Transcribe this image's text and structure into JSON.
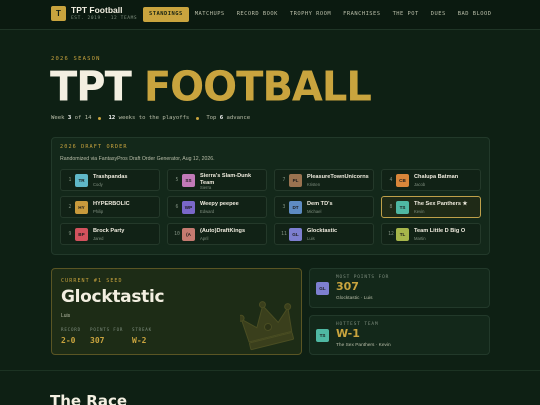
{
  "brand": {
    "logo_letter": "T",
    "name": "TPT Football",
    "subtitle": "EST. 2019 · 12 TEAMS"
  },
  "nav": {
    "items": [
      {
        "label": "STANDINGS",
        "active": true
      },
      {
        "label": "MATCHUPS",
        "active": false
      },
      {
        "label": "RECORD BOOK",
        "active": false
      },
      {
        "label": "TROPHY ROOM",
        "active": false
      },
      {
        "label": "FRANCHISES",
        "active": false
      },
      {
        "label": "THE POT",
        "active": false
      },
      {
        "label": "DUES",
        "active": false
      },
      {
        "label": "BAD BLOOD",
        "active": false
      }
    ]
  },
  "hero": {
    "season_label": "2026 SEASON",
    "title_white": "TPT",
    "title_gold": "FOOTBALL",
    "week_prefix": "Week",
    "week_current": "3",
    "week_of": "of 14",
    "weeks_left": "12",
    "weeks_left_suffix": "weeks to the playoffs",
    "top_prefix": "Top",
    "top_count": "6",
    "top_suffix": "advance"
  },
  "draft": {
    "heading": "2026 DRAFT ORDER",
    "note": "Randomized via FantasyPros Draft Order Generator, Aug 12, 2026.",
    "picks": [
      {
        "num": "1",
        "abbr": "TR",
        "name": "Trashpandas",
        "owner": "Cody",
        "color": "#5fb7c7"
      },
      {
        "num": "5",
        "abbr": "SS",
        "name": "Sierra's Slam-Dunk Team",
        "owner": "Sierra",
        "color": "#c27ab8"
      },
      {
        "num": "7",
        "abbr": "PL",
        "name": "PleasureTownUnicorns",
        "owner": "Kristen",
        "color": "#9a7350"
      },
      {
        "num": "4",
        "abbr": "CB",
        "name": "Chalupa Batman",
        "owner": "Jacob",
        "color": "#d9863a"
      },
      {
        "num": "2",
        "abbr": "HY",
        "name": "HYPERBOLIC",
        "owner": "Philip",
        "color": "#c89a3c"
      },
      {
        "num": "6",
        "abbr": "WP",
        "name": "Weepy peepee",
        "owner": "Edward",
        "color": "#7a67c9"
      },
      {
        "num": "3",
        "abbr": "DT",
        "name": "Dem TD's",
        "owner": "Michael",
        "color": "#5e8bc2"
      },
      {
        "num": "8",
        "abbr": "TS",
        "name": "The Sex Panthers ★",
        "owner": "Kevin",
        "color": "#4fb8a3",
        "highlight": true
      },
      {
        "num": "9",
        "abbr": "BP",
        "name": "Brock Party",
        "owner": "Jared",
        "color": "#d2525d"
      },
      {
        "num": "10",
        "abbr": "(A",
        "name": "(Auto)DraftKings",
        "owner": "April",
        "color": "#c47a70"
      },
      {
        "num": "11",
        "abbr": "GL",
        "name": "Glocktastic",
        "owner": "Luis",
        "color": "#7d7fd0"
      },
      {
        "num": "12",
        "abbr": "TL",
        "name": "Team Little D Big O",
        "owner": "Martin",
        "color": "#a7b64b"
      }
    ]
  },
  "champion": {
    "tag": "CURRENT #1 SEED",
    "name": "Glocktastic",
    "owner": "Luis",
    "stats": [
      {
        "label": "RECORD",
        "value": "2-0"
      },
      {
        "label": "POINTS FOR",
        "value": "307"
      },
      {
        "label": "STREAK",
        "value": "W-2"
      }
    ]
  },
  "most_points": {
    "label": "MOST POINTS FOR",
    "abbr": "GL",
    "value": "307",
    "sub": "Glocktastic · Luis",
    "color": "#7d7fd0"
  },
  "hottest": {
    "label": "HOTTEST TEAM",
    "abbr": "TS",
    "value": "W-1",
    "sub": "The Sex Panthers · Kevin",
    "color": "#4fb8a3"
  },
  "next_section": {
    "title": "The Race"
  },
  "colors": {
    "background": "#0e2014",
    "gold": "#c9a43e"
  },
  "icons": {
    "crown": "crown-icon"
  }
}
